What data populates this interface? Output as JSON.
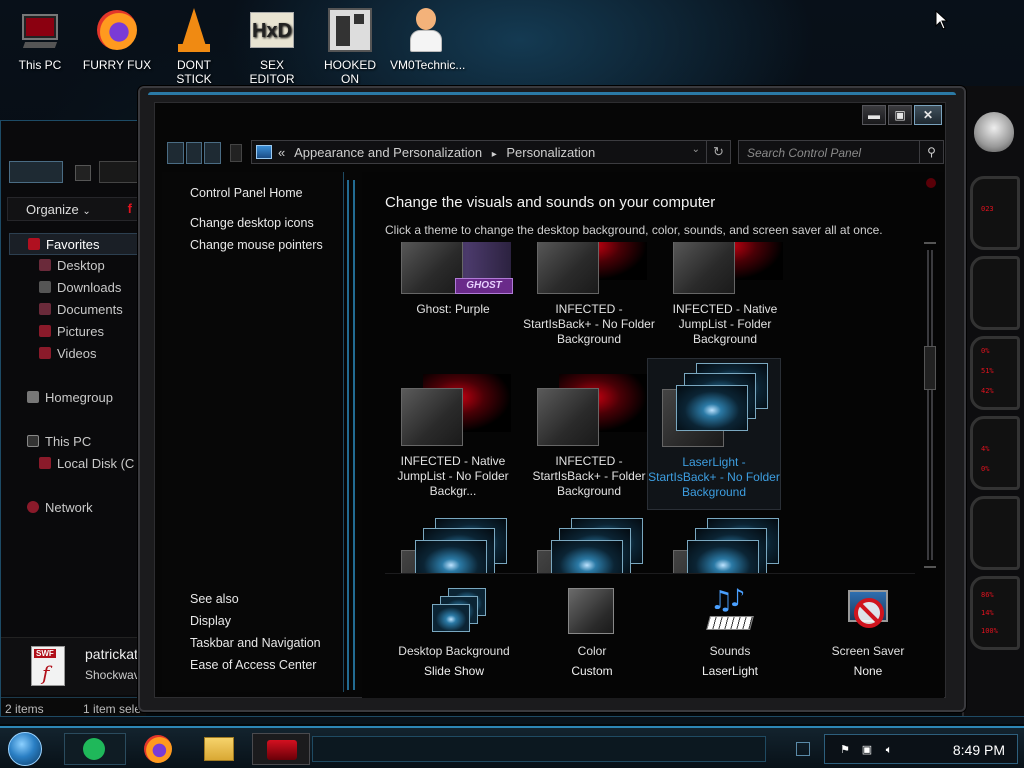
{
  "desktop": {
    "icons": [
      {
        "label": "This PC",
        "icon": "this-pc-icon"
      },
      {
        "label": "FURRY FUX",
        "icon": "firefox-icon"
      },
      {
        "label": "DONT STICK\nTHIS IN YO...",
        "icon": "vlc-cone-icon"
      },
      {
        "label": "SEX EDITOR",
        "icon": "hxd-icon"
      },
      {
        "label": "HOOKED ON\nXONIX",
        "icon": "xonix-game-icon"
      },
      {
        "label": "VM0Technic...",
        "icon": "doctor-avatar-icon"
      }
    ]
  },
  "explorer": {
    "organize_label": "Organize",
    "nav": [
      {
        "label": "Favorites",
        "icon": "favorites-star-icon",
        "selected": true
      },
      {
        "label": "Desktop",
        "icon": "desktop-folder-icon"
      },
      {
        "label": "Downloads",
        "icon": "downloads-icon"
      },
      {
        "label": "Documents",
        "icon": "documents-icon"
      },
      {
        "label": "Pictures",
        "icon": "pictures-icon"
      },
      {
        "label": "Videos",
        "icon": "videos-icon"
      },
      {
        "label": "Homegroup",
        "icon": "homegroup-icon"
      },
      {
        "label": "This PC",
        "icon": "this-pc-icon"
      },
      {
        "label": "Local Disk (C",
        "icon": "local-disk-icon"
      },
      {
        "label": "Network",
        "icon": "network-icon"
      }
    ],
    "details": {
      "name": "patrickat",
      "type": "Shockwav",
      "badge": "SWF"
    },
    "status": {
      "items": "2 items",
      "selected": "1 item sele"
    }
  },
  "window": {
    "caption_buttons": {
      "minimize": "▬",
      "maximize": "▣",
      "close": "✕"
    },
    "address": {
      "prefix": "«",
      "crumbs": [
        "Appearance and Personalization",
        "Personalization"
      ],
      "separator": "▸"
    },
    "search_placeholder": "Search Control Panel",
    "left_links": {
      "home": "Control Panel Home",
      "items": [
        "Change desktop icons",
        "Change mouse pointers"
      ],
      "see_also_title": "See also",
      "see_also": [
        "Display",
        "Taskbar and Navigation",
        "Ease of Access Center"
      ]
    },
    "content": {
      "title": "Change the visuals and sounds on your computer",
      "subtitle": "Click a theme to change the desktop background, color, sounds, and screen saver all at once.",
      "themes_row1": [
        {
          "label": "Ghost: Purple",
          "thumb": "ghost"
        },
        {
          "label": "INFECTED - StartIsBack+ - No Folder Background",
          "thumb": "red"
        },
        {
          "label": "INFECTED - Native JumpList - Folder Background",
          "thumb": "red"
        }
      ],
      "themes_row2": [
        {
          "label": "INFECTED - Native JumpList - No Folder Backgr...",
          "thumb": "red"
        },
        {
          "label": "INFECTED - StartIsBack+ - Folder Background",
          "thumb": "red"
        },
        {
          "label": "LaserLight - StartIsBack+ - No Folder Background",
          "thumb": "laser",
          "selected": true
        }
      ],
      "ghost_badge": "GHOST"
    },
    "bottom": [
      {
        "title": "Desktop Background",
        "value": "Slide Show",
        "icon": "slideshow-icon"
      },
      {
        "title": "Color",
        "value": "Custom",
        "icon": "color-swatch-icon"
      },
      {
        "title": "Sounds",
        "value": "LaserLight",
        "icon": "music-notes-icon"
      },
      {
        "title": "Screen Saver",
        "value": "None",
        "icon": "screensaver-none-icon"
      }
    ]
  },
  "taskbar": {
    "pinned": [
      "sway-app-icon",
      "firefox-icon",
      "file-explorer-icon",
      "alienware-icon"
    ],
    "clock": "8:49 PM",
    "tray_icons": [
      "action-center-flag-icon",
      "network-tray-icon",
      "volume-icon"
    ]
  },
  "right_panel": {
    "readouts": [
      "023",
      "0%",
      "51%",
      "42%",
      "4%",
      "0%",
      "86%",
      "14%",
      "100%"
    ]
  },
  "colors": {
    "accent": "#2a85b5",
    "selected_text": "#3d9ee0",
    "alert_red": "#e0121e"
  }
}
